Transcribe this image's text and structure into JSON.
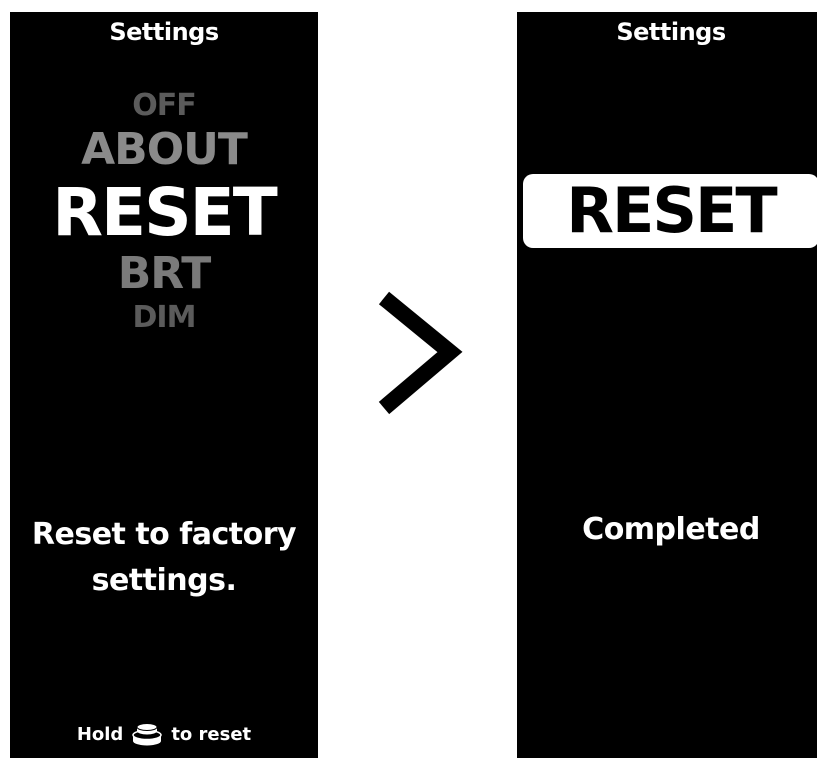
{
  "left_screen": {
    "title": "Settings",
    "menu": {
      "off": "OFF",
      "about": "ABOUT",
      "reset": "RESET",
      "brt": "BRT",
      "dim": "DIM"
    },
    "description_line1": "Reset to factory",
    "description_line2": "settings.",
    "hint": {
      "prefix": "Hold",
      "icon": "button-icon",
      "suffix": "to reset"
    }
  },
  "transition": {
    "icon": "chevron-right-icon"
  },
  "right_screen": {
    "title": "Settings",
    "selected_label": "RESET",
    "status": "Completed"
  },
  "colors": {
    "screen_bg": "#000000",
    "page_bg": "#ffffff",
    "active_text": "#ffffff",
    "inactive_text": "#7a7a7a"
  }
}
